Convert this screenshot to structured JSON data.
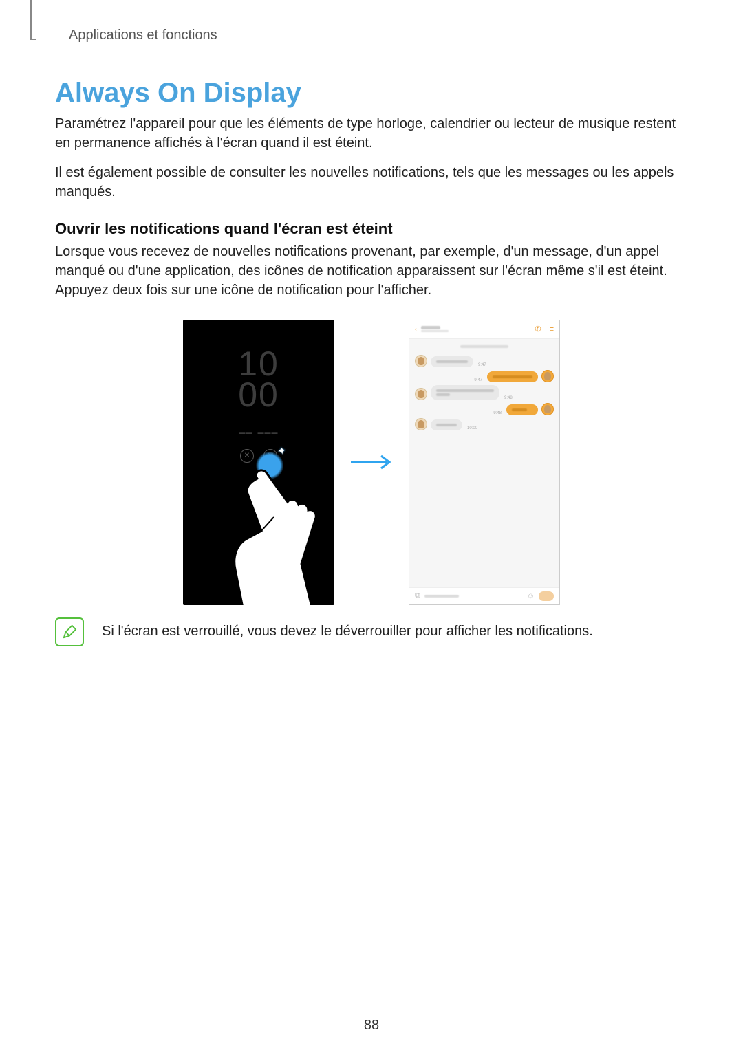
{
  "header": {
    "section_label": "Applications et fonctions"
  },
  "title": "Always On Display",
  "intro_p1": "Paramétrez l'appareil pour que les éléments de type horloge, calendrier ou lecteur de musique restent en permanence affichés à l'écran quand il est éteint.",
  "intro_p2": "Il est également possible de consulter les nouvelles notifications, tels que les messages ou les appels manqués.",
  "sub_heading": "Ouvrir les notifications quand l'écran est éteint",
  "sub_p1": "Lorsque vous recevez de nouvelles notifications provenant, par exemple, d'un message, d'un appel manqué ou d'une application, des icônes de notification apparaissent sur l'écran même s'il est éteint. Appuyez deux fois sur une icône de notification pour l'afficher.",
  "figure": {
    "aod": {
      "clock_top": "10",
      "clock_bottom": "00"
    },
    "chat": {
      "timestamps": {
        "m1": "9:47",
        "m2": "9:47",
        "m3": "9:48",
        "m4": "9:48",
        "m5": "10:00"
      }
    }
  },
  "note_text": "Si l'écran est verrouillé, vous devez le déverrouiller pour afficher les notifications.",
  "page_number": "88"
}
